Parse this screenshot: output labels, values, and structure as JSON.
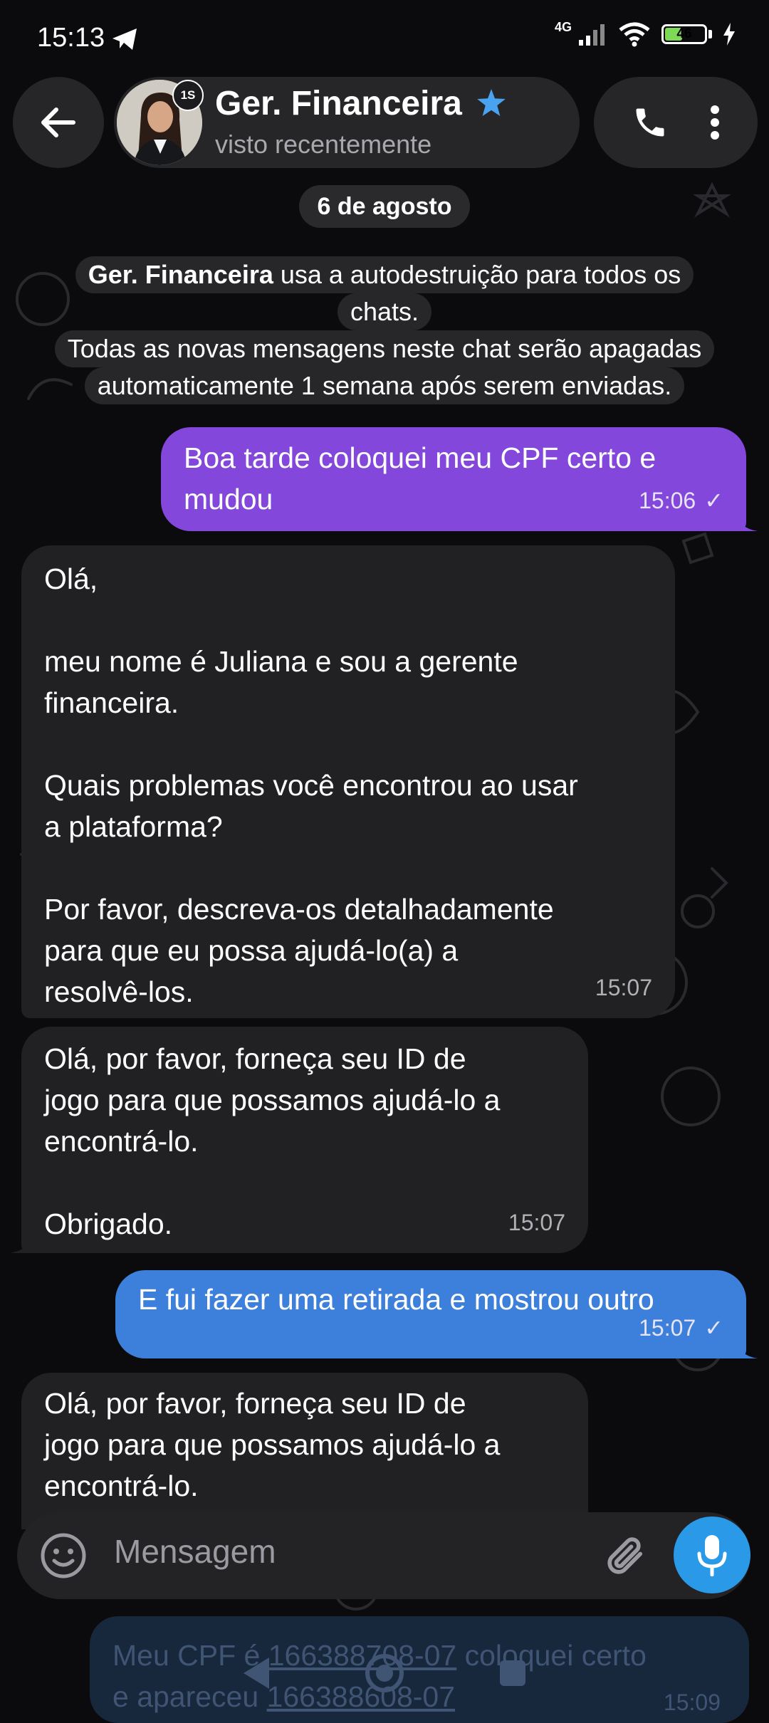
{
  "status_bar": {
    "time": "15:13",
    "network": "4G",
    "battery": "46"
  },
  "header": {
    "contact_name": "Ger. Financeira",
    "contact_status": "visto recentemente",
    "timer_badge": "1S"
  },
  "chat": {
    "date_chip": "6 de agosto",
    "service_message": {
      "bold_name": "Ger. Financeira",
      "line1_rest": " usa a autodestruição para todos os",
      "line2": "chats.",
      "line3": "Todas as novas mensagens neste chat serão apagadas",
      "line4": "automaticamente 1 semana após serem enviadas."
    },
    "messages": [
      {
        "direction": "out",
        "lines": [
          "Boa tarde coloquei meu CPF certo e",
          "mudou"
        ],
        "time": "15:06",
        "check": "✓"
      },
      {
        "direction": "in",
        "lines": [
          "Olá,",
          "",
          "meu nome é Juliana e sou a gerente",
          "financeira.",
          "",
          "Quais problemas você encontrou ao usar",
          "a plataforma?",
          "",
          "Por favor, descreva-os detalhadamente",
          "para que eu possa ajudá-lo(a) a",
          "resolvê-los."
        ],
        "time": "15:07"
      },
      {
        "direction": "in",
        "lines": [
          "Olá, por favor, forneça seu ID de",
          "jogo para que possamos ajudá-lo a",
          "encontrá-lo.",
          "",
          "Obrigado."
        ],
        "time": "15:07"
      },
      {
        "direction": "out",
        "lines": [
          "E fui fazer uma retirada e mostrou outro"
        ],
        "time": "15:07",
        "check": "✓"
      },
      {
        "direction": "in",
        "lines": [
          "Olá, por favor, forneça seu ID de",
          "jogo para que possamos ajudá-lo a",
          "encontrá-lo."
        ]
      }
    ],
    "ghost_message": {
      "line1_a": "Meu CPF é ",
      "line1_b": "166388708-07",
      "line1_c": " coloquei certo",
      "line2_a": "e apareceu ",
      "line2_b": "166388608-07",
      "time": "15:09"
    }
  },
  "input": {
    "placeholder": "Mensagem"
  },
  "colors": {
    "accent_blue": "#3d80dc",
    "accent_purple": "#8347db",
    "mic_blue": "#2a9ae8",
    "verified_star": "#4aa3f0"
  }
}
